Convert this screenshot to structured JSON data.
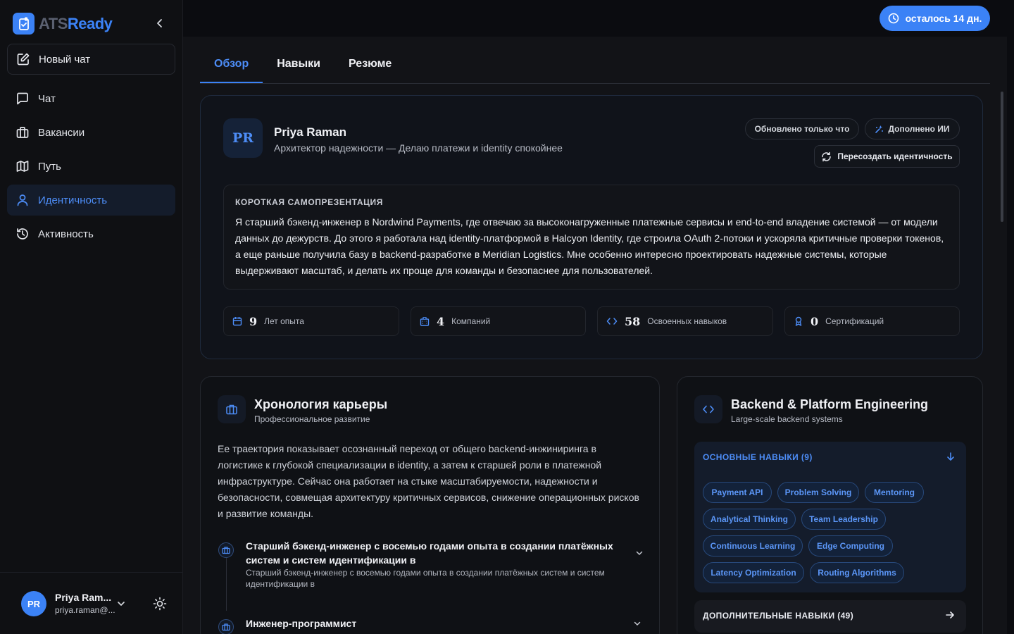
{
  "brand": {
    "name_part1": "ATS",
    "name_part2": "Ready"
  },
  "sidebar": {
    "new_chat": "Новый чат",
    "items": [
      {
        "label": "Чат",
        "icon": "message-square-icon",
        "active": false
      },
      {
        "label": "Вакансии",
        "icon": "briefcase-icon",
        "active": false
      },
      {
        "label": "Путь",
        "icon": "map-icon",
        "active": false
      },
      {
        "label": "Идентичность",
        "icon": "user-icon",
        "active": true
      },
      {
        "label": "Активность",
        "icon": "history-icon",
        "active": false
      }
    ],
    "user": {
      "initials": "PR",
      "name": "Priya Ram...",
      "email": "priya.raman@..."
    }
  },
  "topbar": {
    "trial": "осталось 14 дн."
  },
  "tabs": [
    "Обзор",
    "Навыки",
    "Резюме"
  ],
  "profile": {
    "initials": "PR",
    "name": "Priya Raman",
    "role": "Архитектор надежности — Делаю платежи и identity спокойнее",
    "updated": "Обновлено только что",
    "ai_enhanced": "Дополнено ИИ",
    "regenerate": "Пересоздать идентичность",
    "pitch_title": "КОРОТКАЯ САМОПРЕЗЕНТАЦИЯ",
    "pitch": "Я старший бэкенд-инженер в Nordwind Payments, где отвечаю за высоконагруженные платежные сервисы и end-to-end владение системой — от модели данных до дежурств. До этого я работала над identity-платформой в Halcyon Identity, где строила OAuth 2-потоки и ускоряла критичные проверки токенов, а еще раньше получила базу в backend-разработке в Meridian Logistics. Мне особенно интересно проектировать надежные системы, которые выдерживают масштаб, и делать их проще для команды и безопаснее для пользователей.",
    "stats": [
      {
        "value": "9",
        "label": "Лет опыта",
        "icon": "calendar-icon"
      },
      {
        "value": "4",
        "label": "Компаний",
        "icon": "building-icon"
      },
      {
        "value": "58",
        "label": "Освоенных навыков",
        "icon": "code-icon"
      },
      {
        "value": "0",
        "label": "Сертификаций",
        "icon": "award-icon"
      }
    ]
  },
  "timeline": {
    "title": "Хронология карьеры",
    "subtitle": "Профессиональное развитие",
    "text": "Ее траектория показывает осознанный переход от общего backend-инжиниринга в логистике к глубокой специализации в identity, а затем к старшей роли в платежной инфраструктуре. Сейчас она работает на стыке масштабируемости, надежности и безопасности, совмещая архитектуру критичных сервисов, снижение операционных рисков и развитие команды.",
    "jobs": [
      {
        "title": "Старший бэкенд-инженер с восемью годами опыта в создании платёжных систем и систем идентификации в",
        "desc": "Старший бэкенд-инженер с восемью годами опыта в создании платёжных систем и систем идентификации в"
      },
      {
        "title": "Инженер-программист"
      }
    ]
  },
  "skills": {
    "title": "Backend & Platform Engineering",
    "subtitle": "Large-scale backend systems",
    "core_title": "ОСНОВНЫЕ НАВЫКИ (9)",
    "core": [
      "Payment API",
      "Problem Solving",
      "Mentoring",
      "Analytical Thinking",
      "Team Leadership",
      "Continuous Learning",
      "Edge Computing",
      "Latency Optimization",
      "Routing Algorithms"
    ],
    "extra_title": "ДОПОЛНИТЕЛЬНЫЕ НАВЫКИ (49)"
  },
  "colors": {
    "accent": "#3b82f6",
    "accent_text": "#4d8df7",
    "background": "#0b0c10",
    "panel": "#121317"
  }
}
